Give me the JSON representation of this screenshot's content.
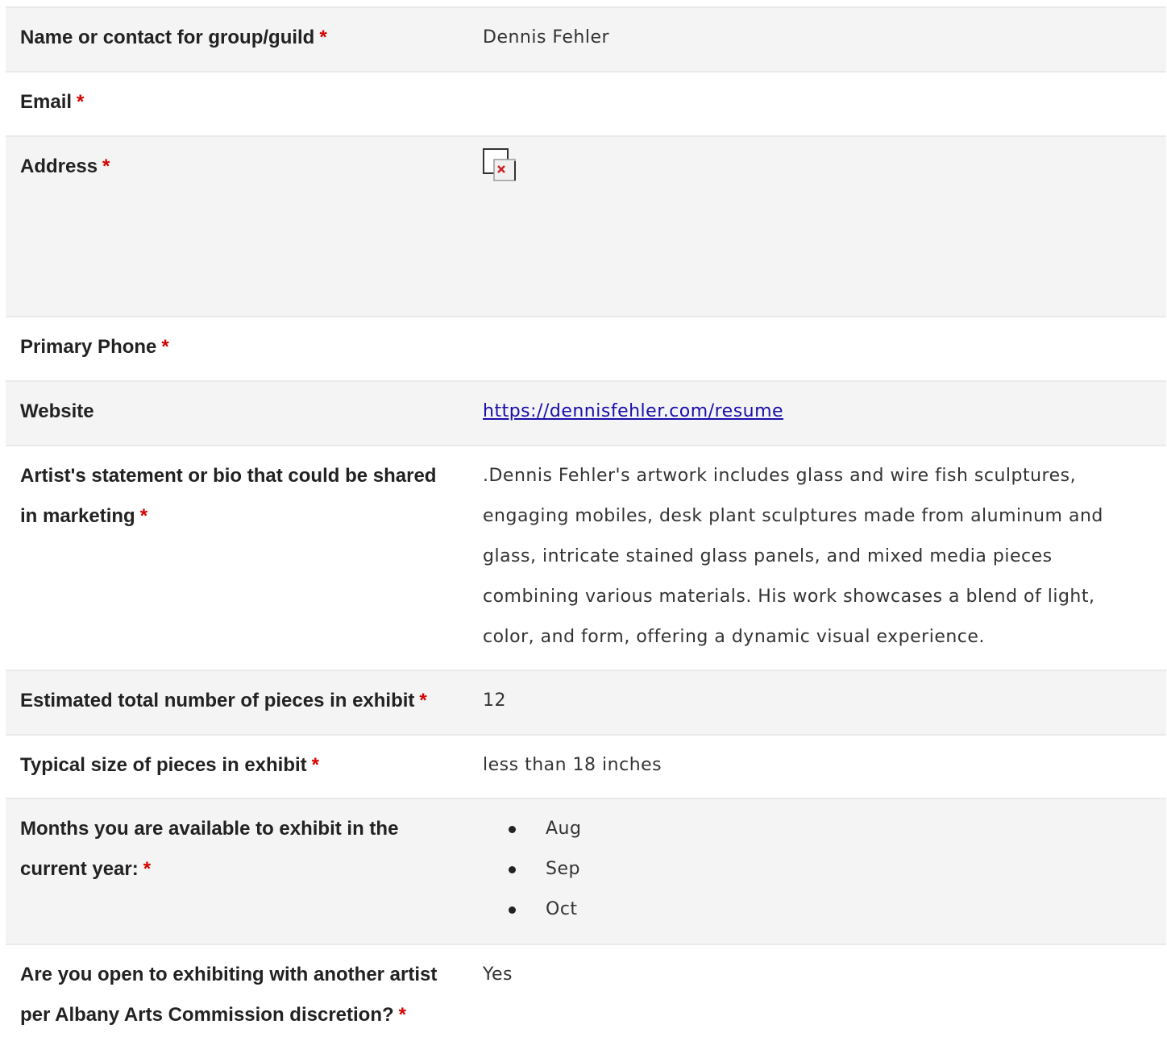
{
  "fields": [
    {
      "label": "Name or contact for group/guild",
      "required": "*",
      "value": "Dennis Fehler"
    },
    {
      "label": "Email",
      "required": "*",
      "value": ""
    },
    {
      "label": "Address",
      "required": "*",
      "value": ""
    },
    {
      "label": "Primary Phone",
      "required": "*",
      "value": ""
    },
    {
      "label": "Website",
      "required": "",
      "value": "https://dennisfehler.com/resume"
    },
    {
      "label": "Artist's statement or bio that could be shared in marketing",
      "required": "*",
      "value": ".Dennis Fehler's artwork includes glass and wire fish sculptures, engaging mobiles, desk plant sculptures made from aluminum and glass, intricate stained glass panels, and mixed media pieces combining various materials. His work showcases a blend of light, color, and form, offering a dynamic visual experience."
    },
    {
      "label": "Estimated total number of pieces in exhibit",
      "required": "*",
      "value": "12"
    },
    {
      "label": "Typical size of pieces in exhibit",
      "required": "*",
      "value": "less than 18 inches"
    },
    {
      "label": "Months you are available to exhibit in the current year:",
      "required": "*",
      "months": [
        "Aug",
        "Sep",
        "Oct"
      ]
    },
    {
      "label": "Are you open to exhibiting with another artist per Albany Arts Commission discretion?",
      "required": "*",
      "value": "Yes"
    }
  ],
  "icons": {
    "address_image": "broken-image-icon"
  },
  "colors": {
    "required": "#d40000",
    "link": "#1a0dab",
    "row_shade": "#f4f4f4"
  }
}
